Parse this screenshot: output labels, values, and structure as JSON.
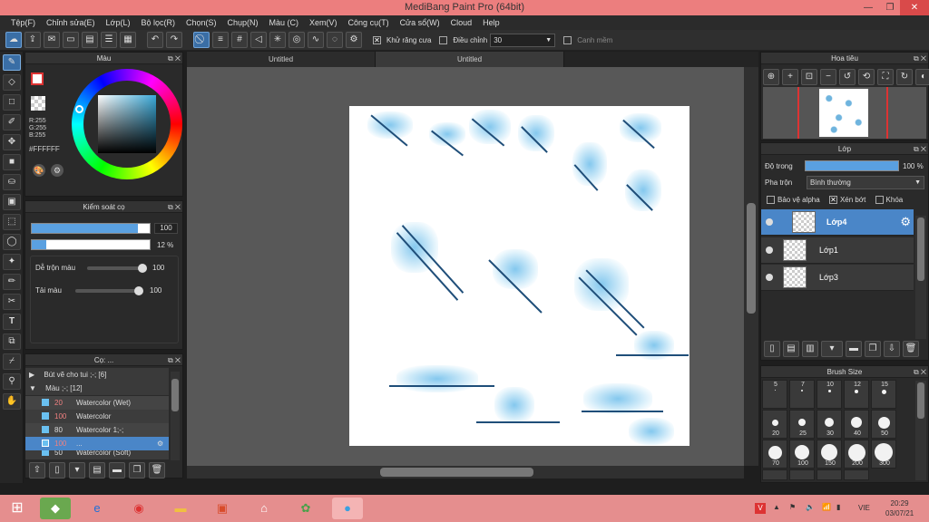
{
  "window": {
    "title": "MediBang Paint Pro (64bit)"
  },
  "menu": [
    "Tệp(F)",
    "Chỉnh sửa(E)",
    "Lớp(L)",
    "Bộ lọc(R)",
    "Chọn(S)",
    "Chụp(N)",
    "Màu (C)",
    "Xem(V)",
    "Công cụ(T)",
    "Cửa sổ(W)",
    "Cloud",
    "Help"
  ],
  "toolbar": {
    "antialias_label": "Khử răng cưa",
    "adjust_label": "Điều chỉnh",
    "adjust_value": "30",
    "margin_label": "Canh mềm"
  },
  "tabs": [
    "Untitled",
    "Untitled"
  ],
  "color_panel": {
    "title": "Màu",
    "rgb": [
      "R:255",
      "G:255",
      "B:255"
    ],
    "hex": "#FFFFFF"
  },
  "brush_control": {
    "title": "Kiểm soát cọ",
    "size_value": "100",
    "opacity_value": "12 %",
    "opacity_fraction": 0.12,
    "blend_label": "Dễ trộn màu",
    "blend_value": "100",
    "amount_label": "Tải màu",
    "amount_value": "100"
  },
  "brush_panel": {
    "title": "Cọ: ...",
    "groups": [
      {
        "label": "Bút vẽ cho tui ;-; [6]"
      },
      {
        "label": "Màu ;-; [12]"
      }
    ],
    "items": [
      {
        "size": "20",
        "name": "Watercolor (Wet)"
      },
      {
        "size": "100",
        "name": "Watercolor"
      },
      {
        "size": "80",
        "name": "Watercolor 1;-;"
      },
      {
        "size": "100",
        "name": "..."
      },
      {
        "size": "50",
        "name": "Watercolor (Soft)"
      }
    ]
  },
  "navigator": {
    "title": "Hoa tiêu"
  },
  "layer_panel": {
    "title": "Lớp",
    "opacity_label": "Độ trong",
    "opacity_value": "100 %",
    "blend_label": "Pha trộn",
    "blend_value": "Bình thường",
    "protect_alpha": "Bảo vệ alpha",
    "clip": "Xén bớt",
    "lock": "Khóa",
    "layers": [
      {
        "name": "Lớp4"
      },
      {
        "name": "Lớp1"
      },
      {
        "name": "Lớp3"
      }
    ]
  },
  "brush_size_panel": {
    "title": "Brush Size",
    "sizes": [
      "5",
      "7",
      "10",
      "12",
      "15",
      "20",
      "25",
      "30",
      "40",
      "50",
      "70",
      "100",
      "150",
      "200",
      "300"
    ]
  },
  "taskbar": {
    "time": "20:29",
    "date": "03/07/21",
    "lang": "VIE"
  },
  "colors": {
    "accent": "#4a86c8",
    "titlebar": "#ec7e7e",
    "taskbar": "#e58e8e"
  }
}
